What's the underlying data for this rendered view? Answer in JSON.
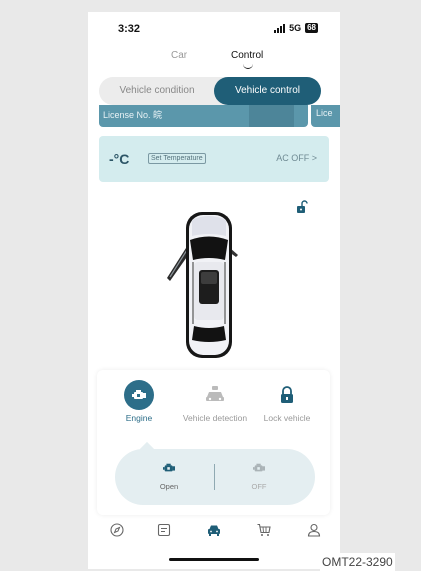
{
  "status_bar": {
    "time": "3:32",
    "network": "5G",
    "battery": "68"
  },
  "top_tabs": {
    "car": "Car",
    "control": "Control"
  },
  "segment": {
    "vehicle_condition": "Vehicle condition",
    "vehicle_control": "Vehicle control"
  },
  "license": {
    "label": "License No. 皖",
    "label_partial": "Lice"
  },
  "temperature": {
    "value": "-°C",
    "set_button": "Set Temperature",
    "ac_status": "AC OFF >"
  },
  "controls": {
    "engine": "Engine",
    "vehicle_detection": "Vehicle detection",
    "lock_vehicle": "Lock vehicle"
  },
  "engine_actions": {
    "open": "Open",
    "off": "OFF"
  },
  "bottom_nav": [
    "discover-icon",
    "message-icon",
    "car-icon",
    "cart-icon",
    "profile-icon"
  ],
  "footer": {
    "code": "OMT22-3290"
  },
  "colors": {
    "accent": "#1f5e77",
    "temp_card": "#d4ecee",
    "license_banner": "#5b97ab"
  }
}
